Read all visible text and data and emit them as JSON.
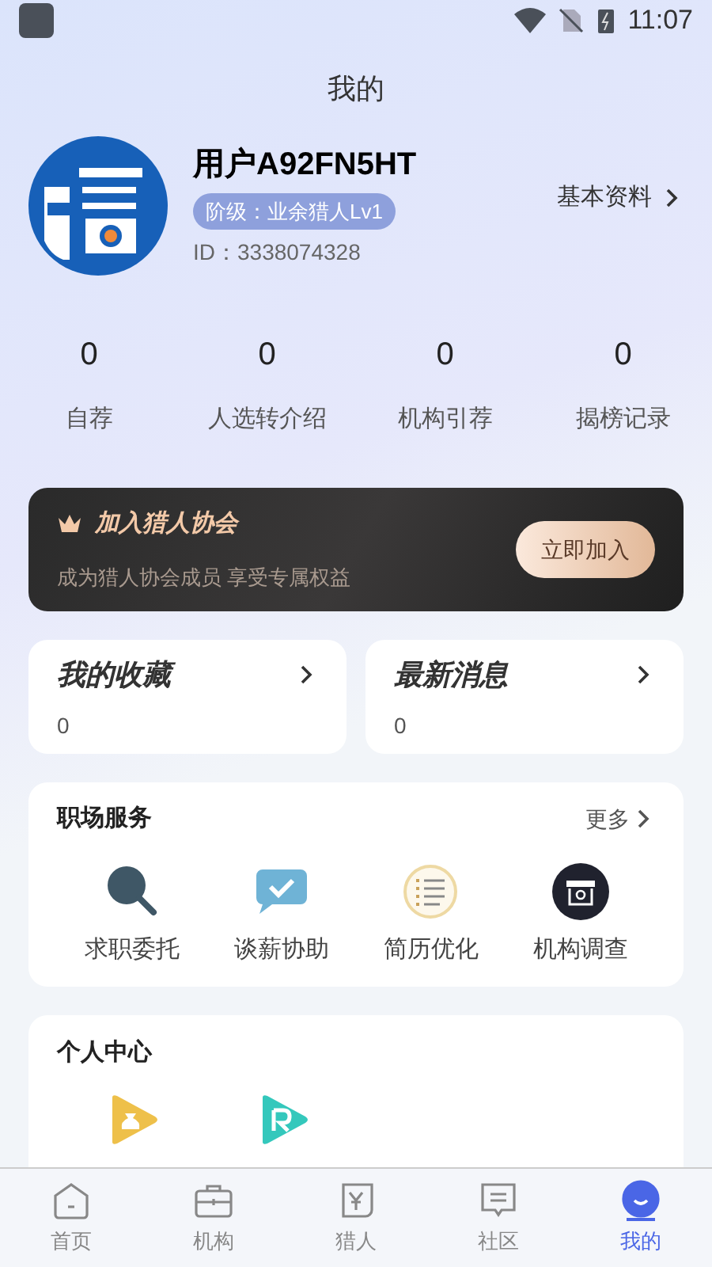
{
  "status_bar": {
    "time": "11:07"
  },
  "title": "我的",
  "profile": {
    "name": "用户A92FN5HT",
    "level_badge": "阶级：业余猎人Lv1",
    "id": "ID：3338074328",
    "link": "基本资料"
  },
  "stats": [
    {
      "value": "0",
      "label": "自荐"
    },
    {
      "value": "0",
      "label": "人选转介绍"
    },
    {
      "value": "0",
      "label": "机构引荐"
    },
    {
      "value": "0",
      "label": "揭榜记录"
    }
  ],
  "banner": {
    "title": "加入猎人协会",
    "subtitle": "成为猎人协会成员 享受专属权益",
    "button": "立即加入"
  },
  "quick_cards": [
    {
      "title": "我的收藏",
      "count": "0"
    },
    {
      "title": "最新消息",
      "count": "0"
    }
  ],
  "services": {
    "title": "职场服务",
    "more": "更多",
    "items": [
      {
        "kind": "job",
        "label": "求职委托"
      },
      {
        "kind": "chat",
        "label": "谈薪协助"
      },
      {
        "kind": "resume",
        "label": "简历优化"
      },
      {
        "kind": "shop",
        "label": "机构调查"
      }
    ]
  },
  "personal": {
    "title": "个人中心",
    "items": [
      {
        "kind": "wallet"
      },
      {
        "kind": "order"
      }
    ]
  },
  "tabs": [
    {
      "kind": "home",
      "label": "首页",
      "selected": false
    },
    {
      "kind": "org",
      "label": "机构",
      "selected": false
    },
    {
      "kind": "hunter",
      "label": "猎人",
      "selected": false
    },
    {
      "kind": "community",
      "label": "社区",
      "selected": false
    },
    {
      "kind": "me",
      "label": "我的",
      "selected": true
    }
  ]
}
